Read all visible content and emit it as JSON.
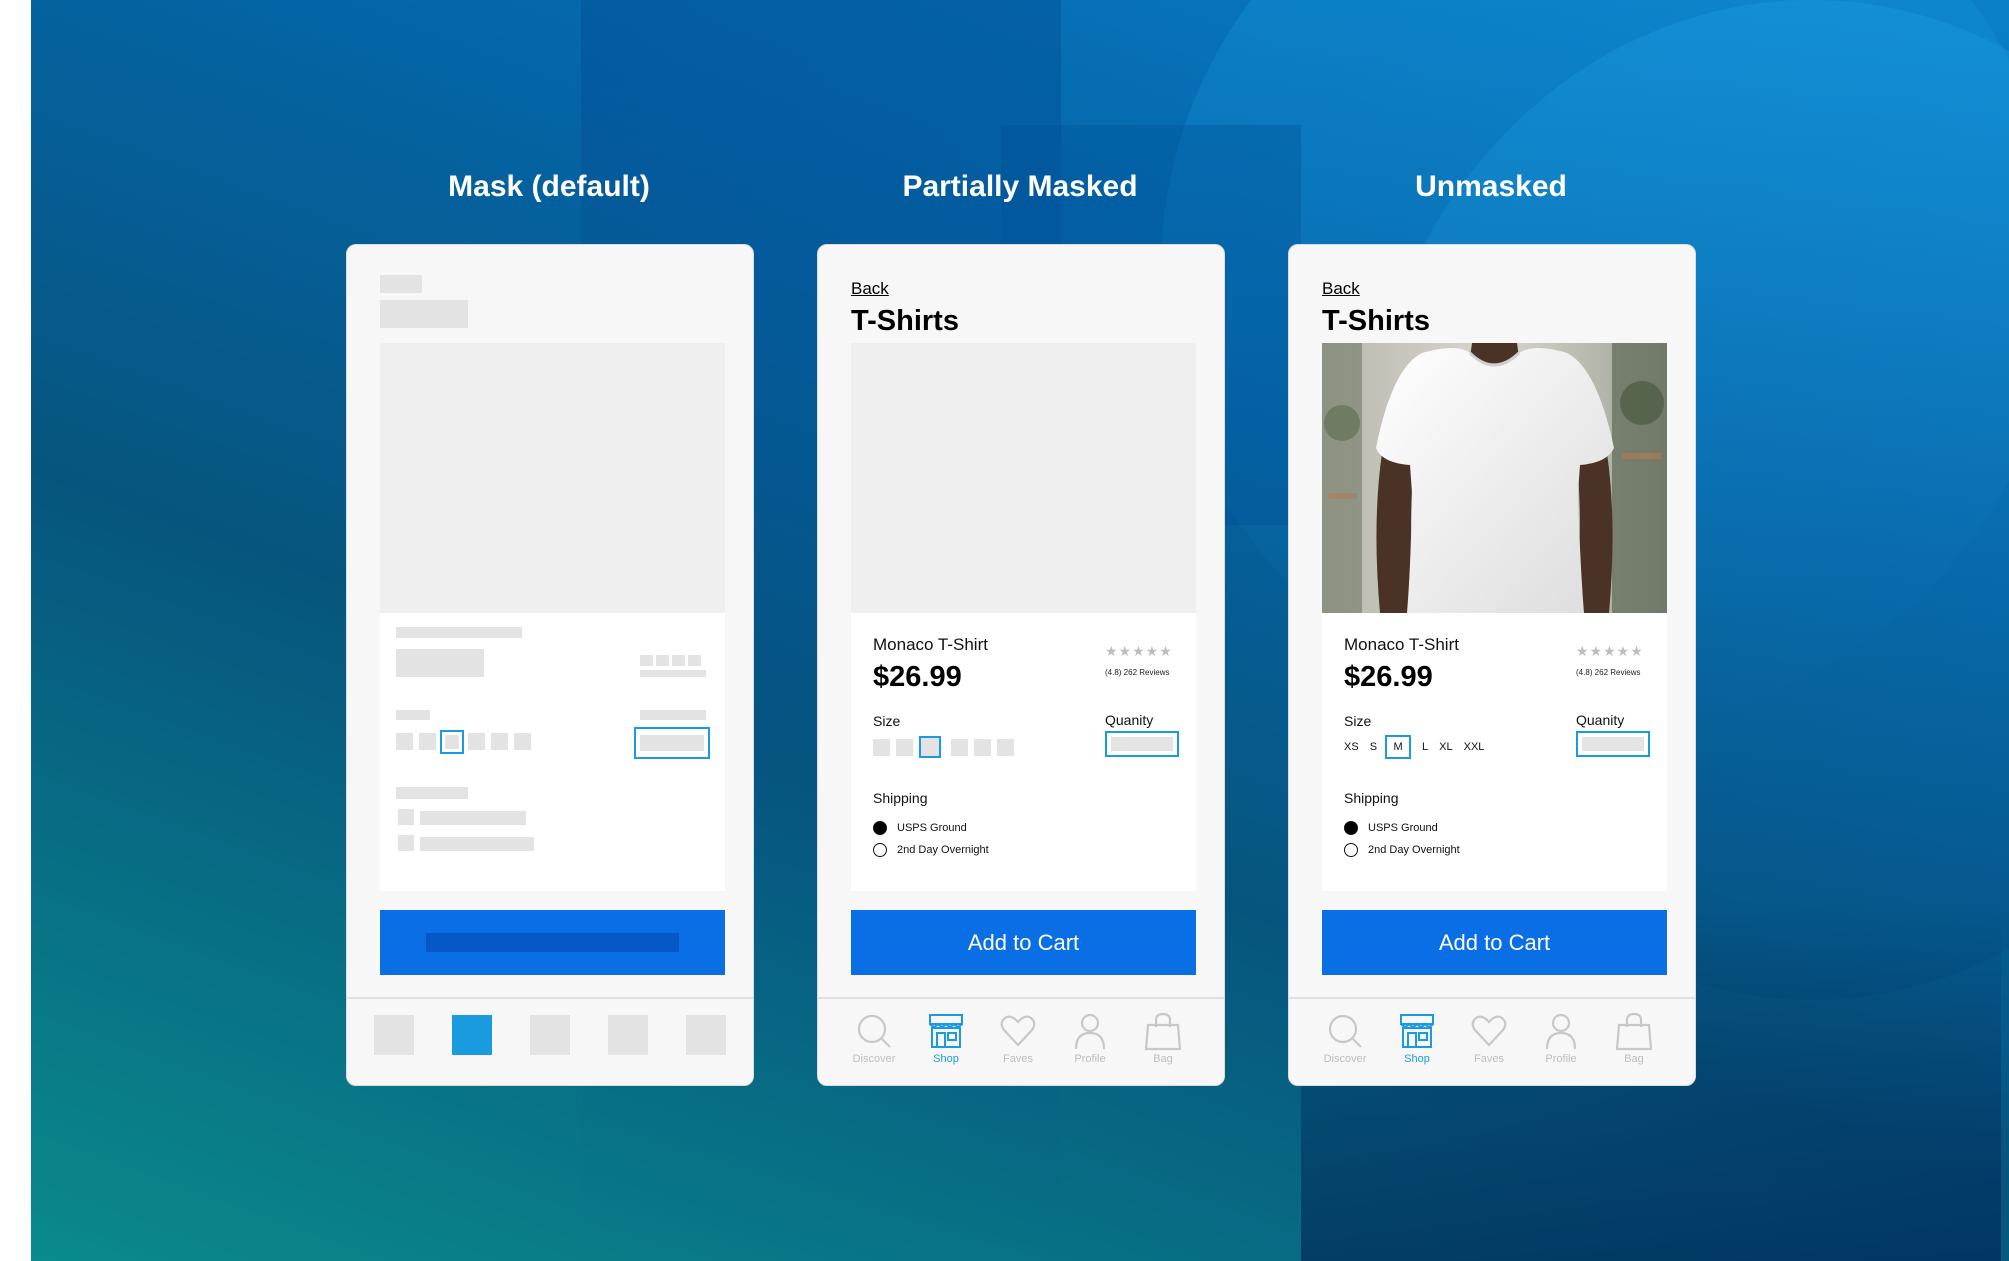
{
  "columns": [
    {
      "title": "Mask (default)"
    },
    {
      "title": "Partially Masked"
    },
    {
      "title": "Unmasked"
    }
  ],
  "screen": {
    "back": "Back",
    "title": "T-Shirts",
    "product_name": "Monaco T-Shirt",
    "price": "$26.99",
    "stars": "★★★★★",
    "reviews": "(4.8) 262 Reviews",
    "size_label": "Size",
    "sizes": [
      "XS",
      "S",
      "M",
      "L",
      "XL",
      "XXL"
    ],
    "selected_size": "M",
    "quantity_label": "Quanity",
    "shipping_label": "Shipping",
    "shipping_options": [
      {
        "label": "USPS Ground",
        "selected": true
      },
      {
        "label": "2nd Day Overnight",
        "selected": false
      }
    ],
    "cta": "Add to Cart",
    "tabs": [
      {
        "label": "Discover",
        "icon": "search-icon"
      },
      {
        "label": "Shop",
        "icon": "storefront-icon",
        "active": true
      },
      {
        "label": "Faves",
        "icon": "heart-icon"
      },
      {
        "label": "Profile",
        "icon": "person-icon"
      },
      {
        "label": "Bag",
        "icon": "shopping-bag-icon"
      }
    ]
  },
  "colors": {
    "accent": "#0a6fe5",
    "active_tab": "#1a9be0",
    "mask": "#e3e3e3"
  }
}
